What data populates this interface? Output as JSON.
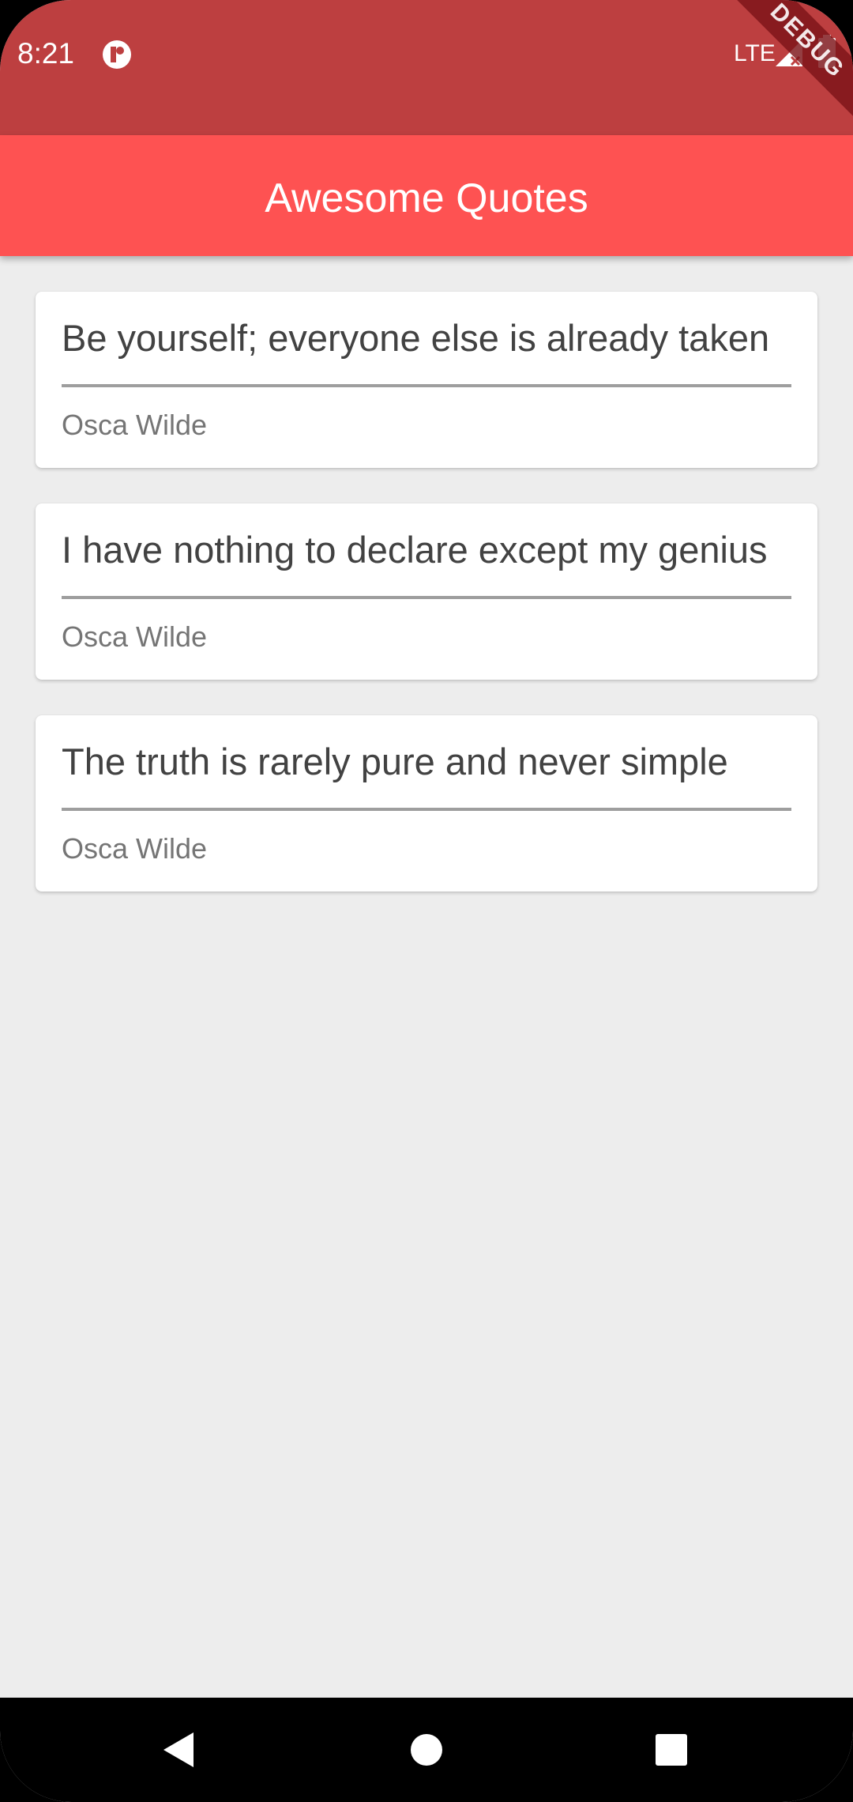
{
  "status_bar": {
    "time": "8:21",
    "network": "LTE",
    "debug_label": "DEBUG",
    "background_color": "#bd3f40",
    "app_icon": "app-notification-icon",
    "signal_icon": "signal-icon",
    "battery_icon": "battery-icon"
  },
  "app_bar": {
    "title": "Awesome Quotes",
    "background_color": "#fe5252"
  },
  "quotes": [
    {
      "text": "Be yourself; everyone else is already taken",
      "author": "Osca Wilde"
    },
    {
      "text": "I have nothing to declare except my genius",
      "author": "Osca Wilde"
    },
    {
      "text": "The truth is rarely pure and never simple",
      "author": "Osca Wilde"
    }
  ],
  "navigation": {
    "back_icon": "back-icon",
    "home_icon": "home-icon",
    "recents_icon": "recents-icon"
  }
}
